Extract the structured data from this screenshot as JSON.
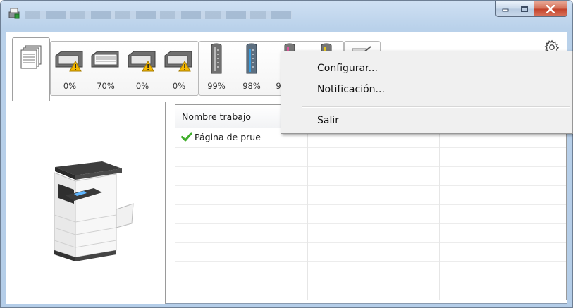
{
  "window": {
    "title": "",
    "buttons": {
      "minimize": "minimize-icon",
      "maximize": "maximize-icon",
      "close": "close-icon"
    }
  },
  "toolbar": {
    "trays": [
      {
        "name": "tray-1",
        "level": "0%",
        "warning": true
      },
      {
        "name": "tray-2",
        "level": "70%",
        "warning": false
      },
      {
        "name": "tray-3",
        "level": "0%",
        "warning": true
      },
      {
        "name": "tray-4",
        "level": "0%",
        "warning": true
      }
    ],
    "toners": [
      {
        "name": "toner-black",
        "level": "99%",
        "color": "#6a6a6a"
      },
      {
        "name": "toner-cyan",
        "level": "98%",
        "color": "#3a9ad9"
      },
      {
        "name": "toner-magenta",
        "level": "9",
        "color": "#e2559f"
      },
      {
        "name": "toner-yellow",
        "level": "",
        "color": "#e8c820"
      }
    ],
    "settings_icon": "gear-icon"
  },
  "job_list": {
    "columns": [
      "Nombre trabajo",
      "",
      "",
      ""
    ],
    "rows": [
      {
        "status_icon": "checkmark-icon",
        "name": "Página de prue",
        "c2": "",
        "c3": "",
        "c4": ""
      }
    ]
  },
  "context_menu": {
    "items": [
      "Configurar...",
      "Notificación...",
      "Salir"
    ]
  },
  "colors": {
    "warning": "#f5b800",
    "check": "#3fae2a",
    "close_button": "#c7452d"
  }
}
